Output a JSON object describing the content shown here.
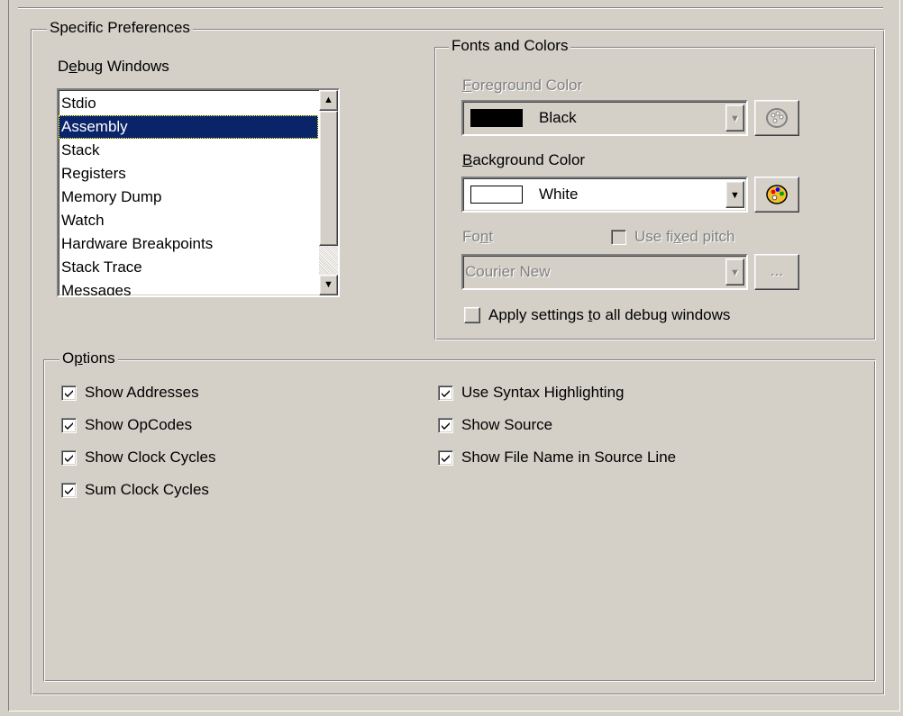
{
  "specific_preferences": {
    "legend": "Specific Preferences"
  },
  "debug_windows": {
    "label_pre": "D",
    "label_mnemonic": "e",
    "label_post": "bug Windows",
    "items": [
      "Stdio",
      "Assembly",
      "Stack",
      "Registers",
      "Memory Dump",
      "Watch",
      "Hardware Breakpoints",
      "Stack Trace",
      "Messages"
    ],
    "selected": "Assembly"
  },
  "fonts_colors": {
    "legend": "Fonts and Colors",
    "foreground": {
      "label_mnemonic": "F",
      "label_post": "oreground Color",
      "value": "Black",
      "swatch_color": "#000000",
      "enabled": false
    },
    "background": {
      "label_mnemonic": "B",
      "label_post": "ackground Color",
      "value": "White",
      "swatch_color": "#ffffff",
      "enabled": true
    },
    "font": {
      "label_pre": "Fo",
      "label_mnemonic": "n",
      "label_post": "t",
      "value": "Courier New",
      "browse_label": "...",
      "enabled": false
    },
    "fixed_pitch": {
      "label_pre": "Use fi",
      "label_mnemonic": "x",
      "label_post": "ed pitch",
      "checked": false,
      "enabled": false
    },
    "apply_all": {
      "label_pre": "Apply settings ",
      "label_mnemonic": "t",
      "label_post": "o all debug windows",
      "checked": false
    }
  },
  "options": {
    "legend_pre": "O",
    "legend_mnemonic": "p",
    "legend_post": "tions",
    "left": [
      {
        "label": "Show Addresses",
        "checked": true
      },
      {
        "label": "Show OpCodes",
        "checked": true
      },
      {
        "label": "Show Clock Cycles",
        "checked": true
      },
      {
        "label": "Sum Clock Cycles",
        "checked": true
      }
    ],
    "right": [
      {
        "label": "Use Syntax Highlighting",
        "checked": true
      },
      {
        "label": "Show Source",
        "checked": true
      },
      {
        "label": "Show File Name in Source Line",
        "checked": true
      }
    ]
  },
  "colors": {
    "face": "#d4d0c8",
    "highlight": "#0a246a",
    "shadow": "#808080"
  },
  "icons": [
    "scroll-up-arrow-icon",
    "scroll-down-arrow-icon",
    "dropdown-arrow-icon",
    "color-palette-icon",
    "check-mark-icon"
  ]
}
